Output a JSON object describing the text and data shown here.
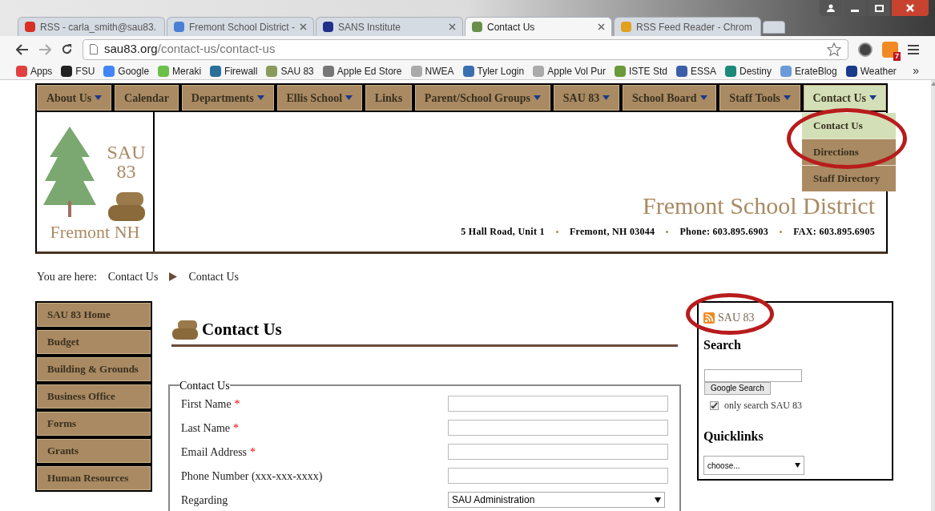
{
  "browser": {
    "tabs": [
      {
        "title": "RSS - carla_smith@sau83.",
        "color": "#d93025",
        "selected": false
      },
      {
        "title": "Fremont School District -",
        "color": "#4a7fd6",
        "selected": false
      },
      {
        "title": "SANS Institute",
        "color": "#1f2f8a",
        "selected": false
      },
      {
        "title": "Contact Us",
        "color": "#6a8f4a",
        "selected": true
      },
      {
        "title": "RSS Feed Reader - Chrom",
        "color": "#e0a020",
        "selected": false
      }
    ],
    "url_host": "sau83.org",
    "url_path": "/contact-us/contact-us",
    "extension_badge": "7",
    "bookmarks": [
      {
        "label": "Apps",
        "color": "#e04040"
      },
      {
        "label": "FSU",
        "color": "#222222"
      },
      {
        "label": "Google",
        "color": "#4285f4"
      },
      {
        "label": "Meraki",
        "color": "#6cc04a"
      },
      {
        "label": "Firewall",
        "color": "#2a6f97"
      },
      {
        "label": "SAU 83",
        "color": "#8a9a5b"
      },
      {
        "label": "Apple Ed Store",
        "color": "#777777"
      },
      {
        "label": "NWEA",
        "color": "#aaaaaa"
      },
      {
        "label": "Tyler Login",
        "color": "#3a6fb0"
      },
      {
        "label": "Apple Vol Pur",
        "color": "#aaaaaa"
      },
      {
        "label": "ISTE Std",
        "color": "#6a9a3a"
      },
      {
        "label": "ESSA",
        "color": "#3a5ea8"
      },
      {
        "label": "Destiny",
        "color": "#1a8a7a"
      },
      {
        "label": "ErateBlog",
        "color": "#6a9ad8"
      },
      {
        "label": "Weather",
        "color": "#1a3a8a"
      }
    ],
    "more_bookmarks": "»"
  },
  "nav": {
    "items": [
      {
        "label": "About Us",
        "dropdown": true,
        "selected": false
      },
      {
        "label": "Calendar",
        "dropdown": false,
        "selected": false
      },
      {
        "label": "Departments",
        "dropdown": true,
        "selected": false
      },
      {
        "label": "Ellis School",
        "dropdown": true,
        "selected": false
      },
      {
        "label": "Links",
        "dropdown": false,
        "selected": false
      },
      {
        "label": "Parent/School Groups",
        "dropdown": true,
        "selected": false
      },
      {
        "label": "SAU 83",
        "dropdown": true,
        "selected": false
      },
      {
        "label": "School Board",
        "dropdown": true,
        "selected": false
      },
      {
        "label": "Staff Tools",
        "dropdown": true,
        "selected": false
      },
      {
        "label": "Contact Us",
        "dropdown": true,
        "selected": true
      }
    ],
    "submenu": [
      {
        "label": "Contact Us",
        "selected": true
      },
      {
        "label": "Directions",
        "selected": false
      },
      {
        "label": "Staff Directory",
        "selected": false
      }
    ]
  },
  "header": {
    "logo_top": "SAU",
    "logo_number": "83",
    "logo_town": "Fremont NH",
    "district": "Fremont School District",
    "address": [
      "5 Hall Road, Unit 1",
      "Fremont, NH 03044",
      "Phone: 603.895.6903",
      "FAX: 603.895.6905"
    ]
  },
  "breadcrumb": {
    "label": "You are here:",
    "items": [
      "Contact Us",
      "Contact Us"
    ]
  },
  "sidebar": {
    "items": [
      "SAU 83 Home",
      "Budget",
      "Building & Grounds",
      "Business Office",
      "Forms",
      "Grants",
      "Human Resources"
    ]
  },
  "main": {
    "title": "Contact Us",
    "form": {
      "legend": "Contact Us",
      "fields": [
        {
          "label": "First Name",
          "required": true,
          "kind": "text"
        },
        {
          "label": "Last Name",
          "required": true,
          "kind": "text"
        },
        {
          "label": "Email Address",
          "required": true,
          "kind": "text"
        },
        {
          "label": "Phone Number (xxx-xxx-xxxx)",
          "required": false,
          "kind": "text"
        },
        {
          "label": "Regarding",
          "required": false,
          "kind": "select",
          "value": "SAU Administration"
        }
      ],
      "required_mark": "*"
    }
  },
  "aside": {
    "feed": "SAU 83",
    "search_heading": "Search",
    "search_button": "Google Search",
    "only_search": {
      "label": "only search SAU 83",
      "checked": true
    },
    "quicklinks_heading": "Quicklinks",
    "quicklinks_value": "choose..."
  }
}
